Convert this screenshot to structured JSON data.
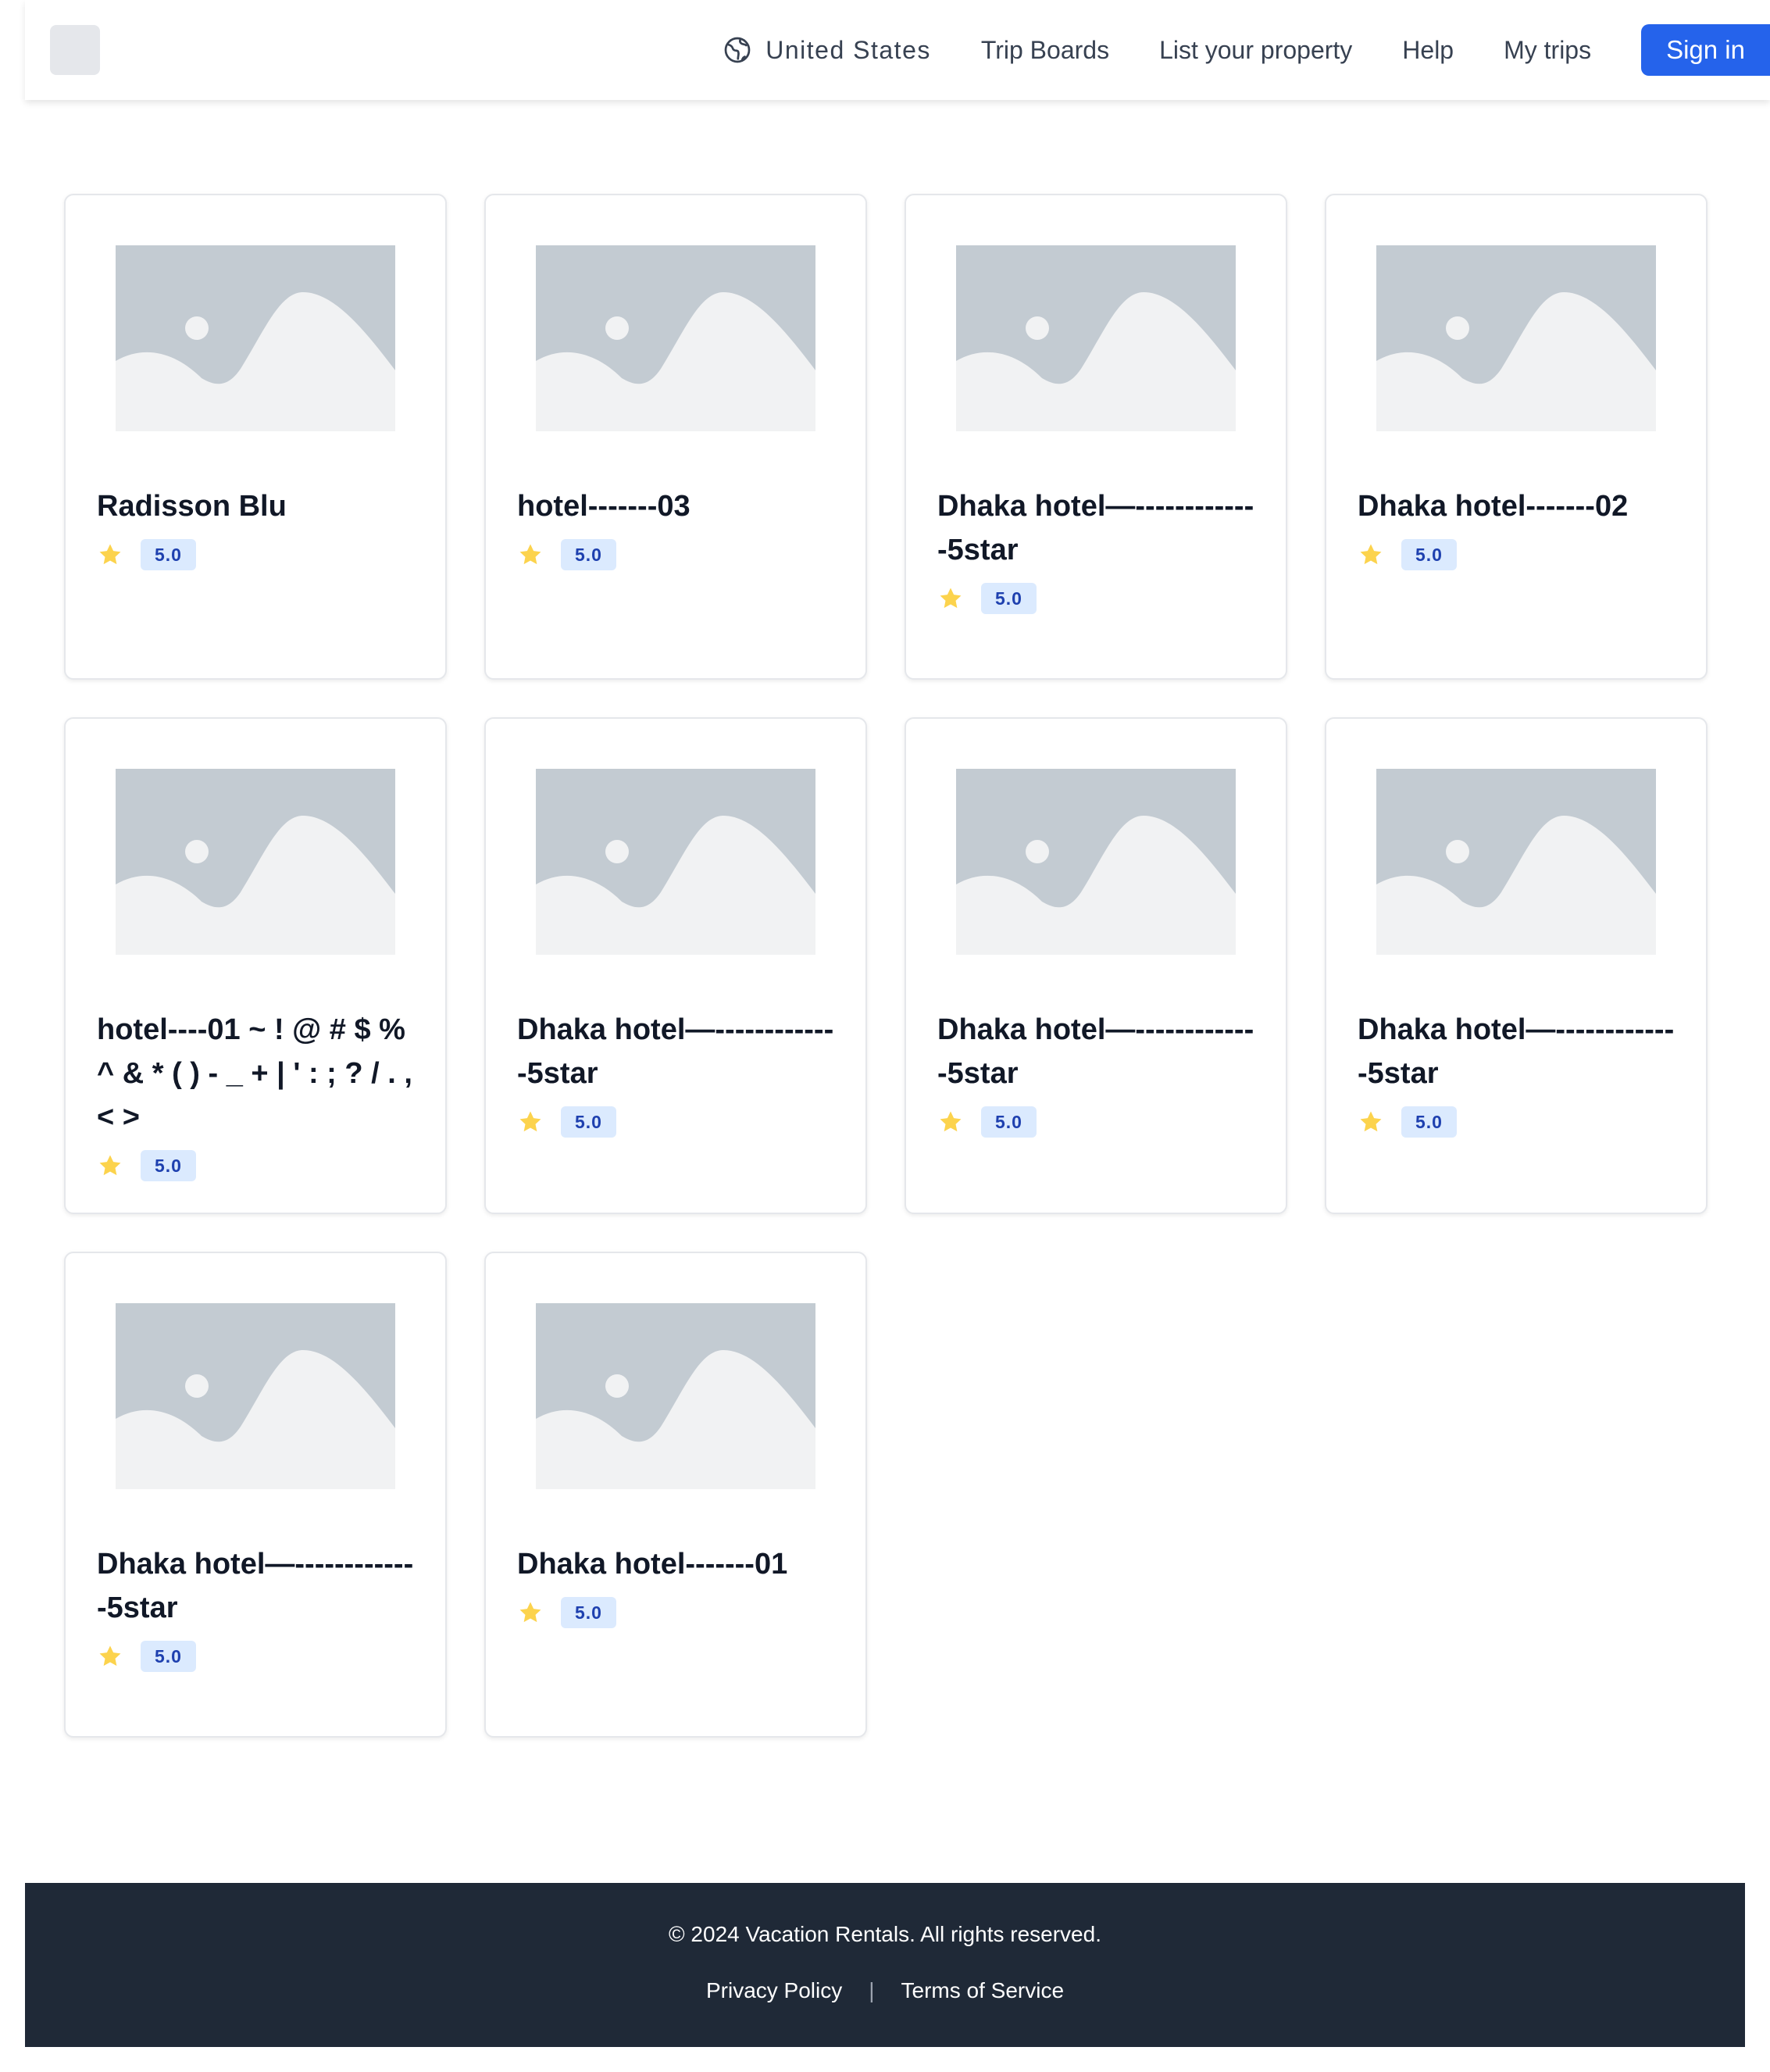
{
  "header": {
    "nav": {
      "country": "United States",
      "trip_boards": "Trip Boards",
      "list_property": "List your property",
      "help": "Help",
      "my_trips": "My trips",
      "sign_in": "Sign in"
    },
    "globe_icon": "globe-icon",
    "accent_color": "#2563eb"
  },
  "listings": [
    {
      "title": "Radisson Blu",
      "rating": "5.0"
    },
    {
      "title": "hotel-------03",
      "rating": "5.0"
    },
    {
      "title": "Dhaka hotel—-------------5star",
      "rating": "5.0"
    },
    {
      "title": "Dhaka hotel-------02",
      "rating": "5.0"
    },
    {
      "title": "hotel----01 ~ ! @ # $ % ^ & * ( ) - _ + | ' : ; ? / . , < >",
      "rating": "5.0"
    },
    {
      "title": "Dhaka hotel—-------------5star",
      "rating": "5.0"
    },
    {
      "title": "Dhaka hotel—-------------5star",
      "rating": "5.0"
    },
    {
      "title": "Dhaka hotel—-------------5star",
      "rating": "5.0"
    },
    {
      "title": "Dhaka hotel—-------------5star",
      "rating": "5.0"
    },
    {
      "title": "Dhaka hotel-------01",
      "rating": "5.0"
    }
  ],
  "icons": {
    "thumbnail": "image-placeholder-icon",
    "rating": "star-icon"
  },
  "colors": {
    "star": "#fcd34d",
    "badge_bg": "#dbeafe",
    "badge_text": "#1e40af",
    "footer_bg": "#1f2937"
  },
  "footer": {
    "copyright": "© 2024 Vacation Rentals. All rights reserved.",
    "privacy": "Privacy Policy",
    "separator": "|",
    "terms": "Terms of Service"
  }
}
